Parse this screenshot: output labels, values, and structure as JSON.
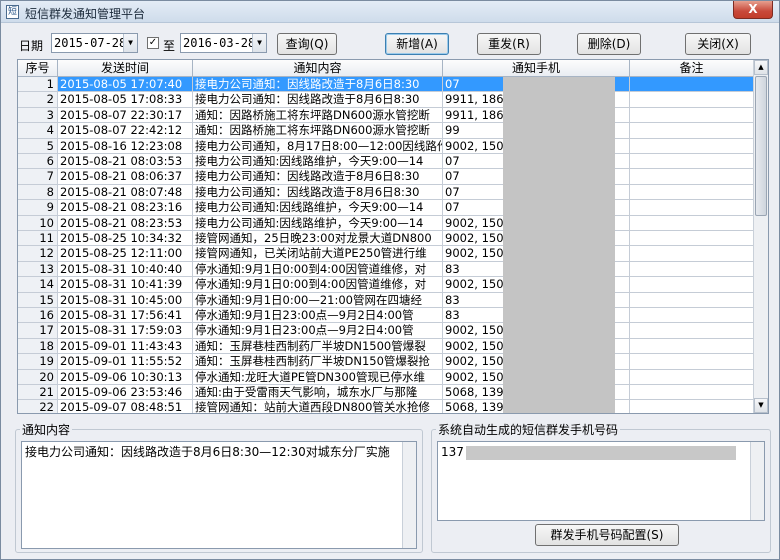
{
  "window": {
    "title": "短信群发通知管理平台",
    "close": "X"
  },
  "toolbar": {
    "date_label": "日期",
    "date_from": "2015-07-28",
    "checkbox_mark": "✓",
    "to_label": "至",
    "date_to": "2016-03-28",
    "query": "查询(Q)",
    "add": "新增(A)",
    "resend": "重发(R)",
    "delete": "删除(D)",
    "close": "关闭(X)"
  },
  "grid": {
    "headers": [
      "序号",
      "发送时间",
      "通知内容",
      "通知手机",
      "备注"
    ],
    "selected_row": 1,
    "rows": [
      {
        "n": "1",
        "time": "2015-08-05 17:07:40",
        "content": "接电力公司通知：因线路改造于8月6日8:30",
        "phone": "07"
      },
      {
        "n": "2",
        "time": "2015-08-05 17:08:33",
        "content": "接电力公司通知：因线路改造于8月6日8:30",
        "phone": "9911, 186776"
      },
      {
        "n": "3",
        "time": "2015-08-07 22:30:17",
        "content": "通知：因路桥施工将东坪路DN600源水管挖断",
        "phone": "9911, 186776"
      },
      {
        "n": "4",
        "time": "2015-08-07 22:42:12",
        "content": "通知：因路桥施工将东坪路DN600源水管挖断",
        "phone": "99"
      },
      {
        "n": "5",
        "time": "2015-08-16 12:23:08",
        "content": "接电力公司通知，8月17日8:00—12:00因线路作业",
        "phone": "9002, 1500"
      },
      {
        "n": "6",
        "time": "2015-08-21 08:03:53",
        "content": "接电力公司通知:因线路维护，今天9:00—14",
        "phone": "07"
      },
      {
        "n": "7",
        "time": "2015-08-21 08:06:37",
        "content": "接电力公司通知：因线路改造于8月6日8:30",
        "phone": "07"
      },
      {
        "n": "8",
        "time": "2015-08-21 08:07:48",
        "content": "接电力公司通知：因线路改造于8月6日8:30",
        "phone": "07"
      },
      {
        "n": "9",
        "time": "2015-08-21 08:23:16",
        "content": "接电力公司通知:因线路维护，今天9:00—14",
        "phone": "07"
      },
      {
        "n": "10",
        "time": "2015-08-21 08:23:53",
        "content": "接电力公司通知:因线路维护，今天9:00—14",
        "phone": "9002, 150083"
      },
      {
        "n": "11",
        "time": "2015-08-25 10:34:32",
        "content": "接管网通知，25日晚23:00对龙景大道DN800",
        "phone": "9002, 150083"
      },
      {
        "n": "12",
        "time": "2015-08-25 12:11:00",
        "content": "接管网通知，已关闭站前大道PE250管进行维",
        "phone": "9002, 150083"
      },
      {
        "n": "13",
        "time": "2015-08-31 10:40:40",
        "content": "停水通知:9月1日0:00到4:00因管道维修，对",
        "phone": "83"
      },
      {
        "n": "14",
        "time": "2015-08-31 10:41:39",
        "content": "停水通知:9月1日0:00到4:00因管道维修，对",
        "phone": "9002, 150083"
      },
      {
        "n": "15",
        "time": "2015-08-31 10:45:00",
        "content": "停水通知:9月1日0:00—21:00管网在四塘经",
        "phone": "83"
      },
      {
        "n": "16",
        "time": "2015-08-31 17:56:41",
        "content": "停水通知:9月1日23:00点—9月2日4:00管",
        "phone": "83"
      },
      {
        "n": "17",
        "time": "2015-08-31 17:59:03",
        "content": "停水通知:9月1日23:00点—9月2日4:00管",
        "phone": "9002, 150083"
      },
      {
        "n": "18",
        "time": "2015-09-01 11:43:43",
        "content": "通知：玉屏巷桂西制药厂半坡DN1500管爆裂",
        "phone": "9002, 150083"
      },
      {
        "n": "19",
        "time": "2015-09-01 11:55:52",
        "content": "通知：玉屏巷桂西制药厂半坡DN150管爆裂抢",
        "phone": "9002, 150083"
      },
      {
        "n": "20",
        "time": "2015-09-06 10:30:13",
        "content": "停水通知:龙旺大道PE管DN300管现已停水维",
        "phone": "9002, 150083"
      },
      {
        "n": "21",
        "time": "2015-09-06 23:53:46",
        "content": "通知:由于受雷雨天气影响，城东水厂与那隆",
        "phone": "5068, 139783"
      },
      {
        "n": "22",
        "time": "2015-09-07 08:48:51",
        "content": "接管网通知：站前大道西段DN800管关水抢修",
        "phone": "5068, 139783"
      }
    ]
  },
  "notice": {
    "legend": "通知内容",
    "text": "接电力公司通知：因线路改造于8月6日8:30—12:30对城东分厂实施"
  },
  "phones": {
    "legend": "系统自动生成的短信群发手机号码",
    "text": "137",
    "config_button": "群发手机号码配置(S)"
  }
}
